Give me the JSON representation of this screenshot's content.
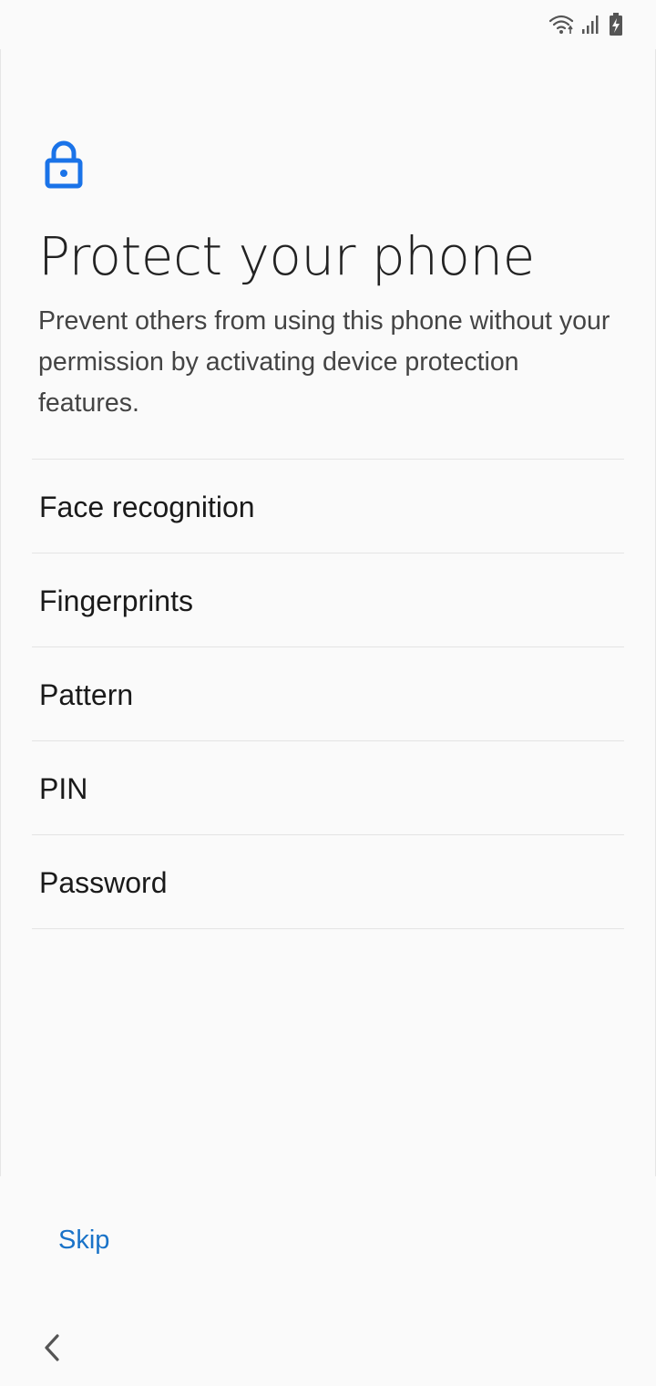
{
  "status_bar": {
    "wifi_icon": "wifi-icon",
    "signal_icon": "signal-icon",
    "battery_icon": "battery-charging-icon"
  },
  "header": {
    "icon": "lock-icon",
    "accent_color": "#1a73e8",
    "title": "Protect your phone",
    "description": "Prevent others from using this phone without your permission by activating device protection features."
  },
  "options": [
    {
      "label": "Face recognition"
    },
    {
      "label": "Fingerprints"
    },
    {
      "label": "Pattern"
    },
    {
      "label": "PIN"
    },
    {
      "label": "Password"
    }
  ],
  "footer": {
    "skip_label": "Skip",
    "skip_color": "#1a73c8",
    "back_icon": "chevron-left-icon"
  }
}
